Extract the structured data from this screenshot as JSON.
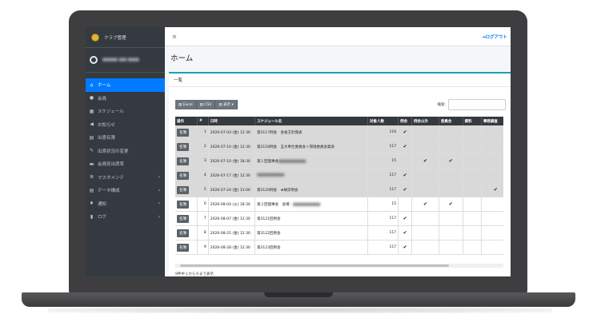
{
  "brand": {
    "title": "クラブ管理"
  },
  "user": {
    "name": "■■■■ ■■ ■■■"
  },
  "topbar": {
    "menu_glyph": "≡",
    "logout": "ログアウト"
  },
  "sidebar": {
    "items": [
      {
        "label": "ホーム",
        "icon": "home-icon",
        "glyph": "⌂",
        "active": true,
        "caret": ""
      },
      {
        "label": "会員",
        "icon": "users-icon",
        "glyph": "●",
        "active": false,
        "caret": ""
      },
      {
        "label": "スケジュール",
        "icon": "calendar-icon",
        "glyph": "▦",
        "active": false,
        "caret": ""
      },
      {
        "label": "お知らせ",
        "icon": "bullhorn-icon",
        "glyph": "◀",
        "active": false,
        "caret": ""
      },
      {
        "label": "出席名簿",
        "icon": "clipboard-icon",
        "glyph": "▤",
        "active": false,
        "caret": ""
      },
      {
        "label": "出席状況の変更",
        "icon": "edit-icon",
        "glyph": "✎",
        "active": false,
        "caret": ""
      },
      {
        "label": "会員別出席率",
        "icon": "card-icon",
        "glyph": "▬",
        "active": false,
        "caret": ""
      },
      {
        "label": "マスタメンテ",
        "icon": "database-icon",
        "glyph": "≣",
        "active": false,
        "caret": "‹"
      },
      {
        "label": "データ構成",
        "icon": "list-icon",
        "glyph": "▤",
        "active": false,
        "caret": "‹"
      },
      {
        "label": "通知",
        "icon": "bell-icon",
        "glyph": "♦",
        "active": false,
        "caret": "‹"
      },
      {
        "label": "ログ",
        "icon": "file-icon",
        "glyph": "▮",
        "active": false,
        "caret": "‹"
      }
    ]
  },
  "page": {
    "title": "ホーム"
  },
  "card": {
    "title": "一覧"
  },
  "toolbar": {
    "excel": "Excel",
    "csv": "CSV",
    "view": "表示"
  },
  "search": {
    "label": "検索:"
  },
  "table": {
    "headers": [
      "操作",
      "#",
      "日時",
      "スケジュール名",
      "対象人数",
      "例会",
      "例会以外",
      "委員会",
      "資料",
      "事務調査"
    ],
    "rows": [
      {
        "btn": "名簿",
        "no": "1",
        "date": "2026-07-03 (金) 12:30",
        "name": "第3117例会　会長方針発表",
        "count": "116",
        "c1": "✔",
        "c2": "",
        "c3": "",
        "c4": "",
        "c5": "",
        "hl": true
      },
      {
        "btn": "名簿",
        "no": "2",
        "date": "2026-07-10 (金) 12:30",
        "name": "第3118例会　五大奉仕委員会＋環境委員会発表",
        "count": "117",
        "c1": "✔",
        "c2": "",
        "c3": "",
        "c4": "",
        "c5": "",
        "hl": true
      },
      {
        "btn": "名簿",
        "no": "3",
        "date": "2026-07-10 (金) 18:30",
        "name": "第１回理事会",
        "count": "15",
        "c1": "",
        "c2": "✔",
        "c3": "✔",
        "c4": "",
        "c5": "",
        "hl": true
      },
      {
        "btn": "名簿",
        "no": "4",
        "date": "2026-07-17 (金) 12:30",
        "name": "",
        "count": "117",
        "c1": "✔",
        "c2": "",
        "c3": "",
        "c4": "",
        "c5": "",
        "hl": true
      },
      {
        "btn": "名簿",
        "no": "5",
        "date": "2026-07-24 (金) 13:00",
        "name": "第3120例会　★納涼例会",
        "count": "117",
        "c1": "✔",
        "c2": "",
        "c3": "",
        "c4": "",
        "c5": "✔",
        "hl": true
      },
      {
        "btn": "名簿",
        "no": "6",
        "date": "2026-08-04 (火) 18:30",
        "name": "第２回理事会　会場：",
        "count": "15",
        "c1": "",
        "c2": "✔",
        "c3": "✔",
        "c4": "",
        "c5": "",
        "hl": false
      },
      {
        "btn": "名簿",
        "no": "7",
        "date": "2026-08-07 (金) 12:30",
        "name": "第3121回例会",
        "count": "117",
        "c1": "✔",
        "c2": "",
        "c3": "",
        "c4": "",
        "c5": "",
        "hl": false
      },
      {
        "btn": "名簿",
        "no": "8",
        "date": "2026-08-21 (金) 12:30",
        "name": "第3122回例会",
        "count": "117",
        "c1": "✔",
        "c2": "",
        "c3": "",
        "c4": "",
        "c5": "",
        "hl": false
      },
      {
        "btn": "名簿",
        "no": "9",
        "date": "2026-08-28 (金) 12:30",
        "name": "第3123回例会",
        "count": "117",
        "c1": "✔",
        "c2": "",
        "c3": "",
        "c4": "",
        "c5": "",
        "hl": false
      }
    ]
  },
  "footer": {
    "info": "9件中１から９まで表示"
  }
}
